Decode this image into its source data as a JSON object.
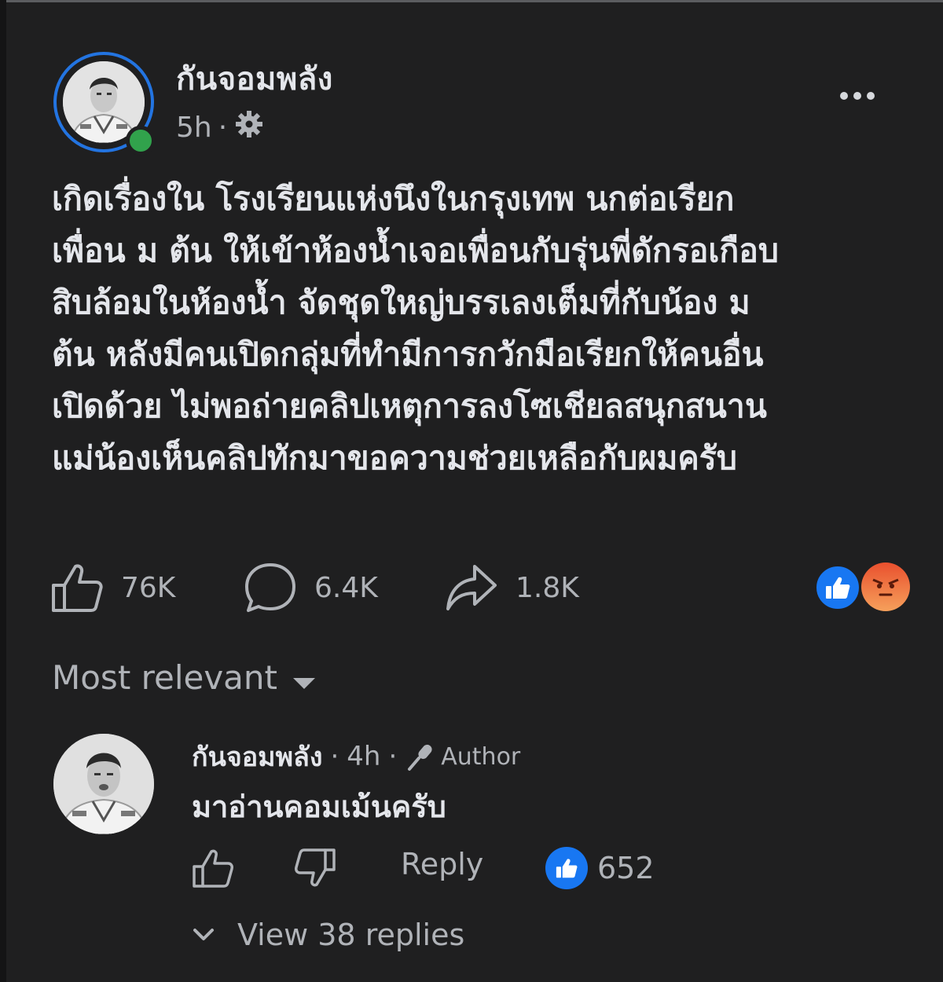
{
  "post": {
    "author": "กันจอมพลัง",
    "time": "5h",
    "separator": "·",
    "privacy_icon": "gear-icon",
    "body_lines": [
      "เกิดเรื่องใน โรงเรียนแห่งนึงในกรุงเทพ นกต่อเรียก",
      "เพื่อน ม ต้น ให้เข้าห้องน้ำเจอเพื่อนกับรุ่นพี่ดักรอเกือบ",
      "สิบล้อมในห้องน้ำ จัดชุดใหญ่บรรเลงเต็มที่กับน้อง ม",
      "ต้น หลังมีคนเปิดกลุ่มที่ทำมีการกวักมือเรียกให้คนอื่น",
      "เปิดด้วย ไม่พอถ่ายคลิปเหตุการลงโซเชียลสนุกสนาน",
      "แม่น้องเห็นคลิปทักมาขอความช่วยเหลือกับผมครับ"
    ]
  },
  "actions": {
    "likes": "76K",
    "comments": "6.4K",
    "shares": "1.8K"
  },
  "reactions": [
    "like",
    "angry"
  ],
  "sort": {
    "label": "Most relevant"
  },
  "comment": {
    "author": "กันจอมพลัง",
    "sep1": "·",
    "time": "4h",
    "sep2": "·",
    "badge": "Author",
    "text": "มาอ่านคอมเม้นครับ",
    "reply_label": "Reply",
    "reaction_count": "652",
    "view_replies": "View 38 replies"
  },
  "colors": {
    "background": "#1f1f20",
    "text": "#e4e6eb",
    "secondary": "#b0b3b8",
    "accent": "#1877f2",
    "online": "#31a24c"
  }
}
